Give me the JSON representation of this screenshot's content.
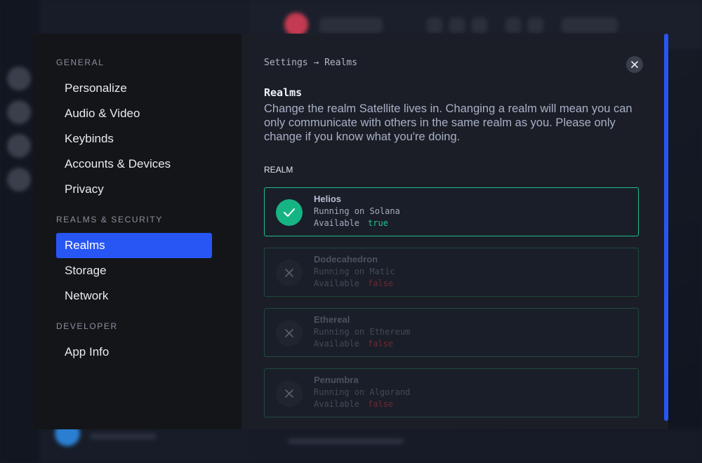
{
  "nav": {
    "groups": [
      {
        "heading": "GENERAL",
        "items": [
          "Personalize",
          "Audio & Video",
          "Keybinds",
          "Accounts & Devices",
          "Privacy"
        ]
      },
      {
        "heading": "REALMS & SECURITY",
        "items": [
          "Realms",
          "Storage",
          "Network"
        ]
      },
      {
        "heading": "DEVELOPER",
        "items": [
          "App Info"
        ]
      }
    ],
    "active": "Realms"
  },
  "breadcrumb": {
    "root": "Settings",
    "separator": "→",
    "current": "Realms"
  },
  "content": {
    "title": "Realms",
    "description": "Change the realm Satellite lives in. Changing a realm will mean you can only communicate with others in the same realm as you. Please only change if you know what you're doing.",
    "realm_label": "REALM"
  },
  "realms": [
    {
      "name": "Helios",
      "chain": "Running on Solana",
      "available_label": "Available",
      "available": "true",
      "selected": true,
      "icon": "check-icon"
    },
    {
      "name": "Dodecahedron",
      "chain": "Running on Matic",
      "available_label": "Available",
      "available": "false",
      "selected": false,
      "icon": "x-icon"
    },
    {
      "name": "Ethereal",
      "chain": "Running on Ethereum",
      "available_label": "Available",
      "available": "false",
      "selected": false,
      "icon": "x-icon"
    },
    {
      "name": "Penumbra",
      "chain": "Running on Algorand",
      "available_label": "Available",
      "available": "false",
      "selected": false,
      "icon": "x-icon"
    }
  ],
  "colors": {
    "accent": "#2756f5",
    "success": "#16b483",
    "danger": "#6b2a33",
    "modal_bg": "#1b1e26",
    "nav_bg": "#141518"
  }
}
